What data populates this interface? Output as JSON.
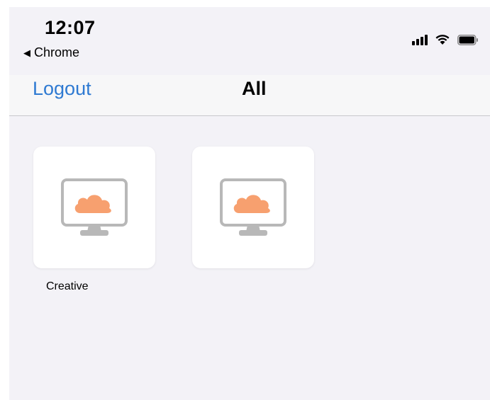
{
  "status_bar": {
    "time": "12:07",
    "back_app": "Chrome",
    "icons": [
      "signal-icon",
      "wifi-icon",
      "battery-icon"
    ]
  },
  "nav": {
    "left_button": "Logout",
    "title": "All"
  },
  "apps": [
    {
      "label": "Creative",
      "icon": "monitor-cloud-icon"
    },
    {
      "label": "",
      "icon": "monitor-cloud-icon"
    }
  ],
  "colors": {
    "accent": "#2f7ad2",
    "cloud": "#f7a06f",
    "monitor": "#b8b8b8",
    "background": "#f3f2f7"
  }
}
